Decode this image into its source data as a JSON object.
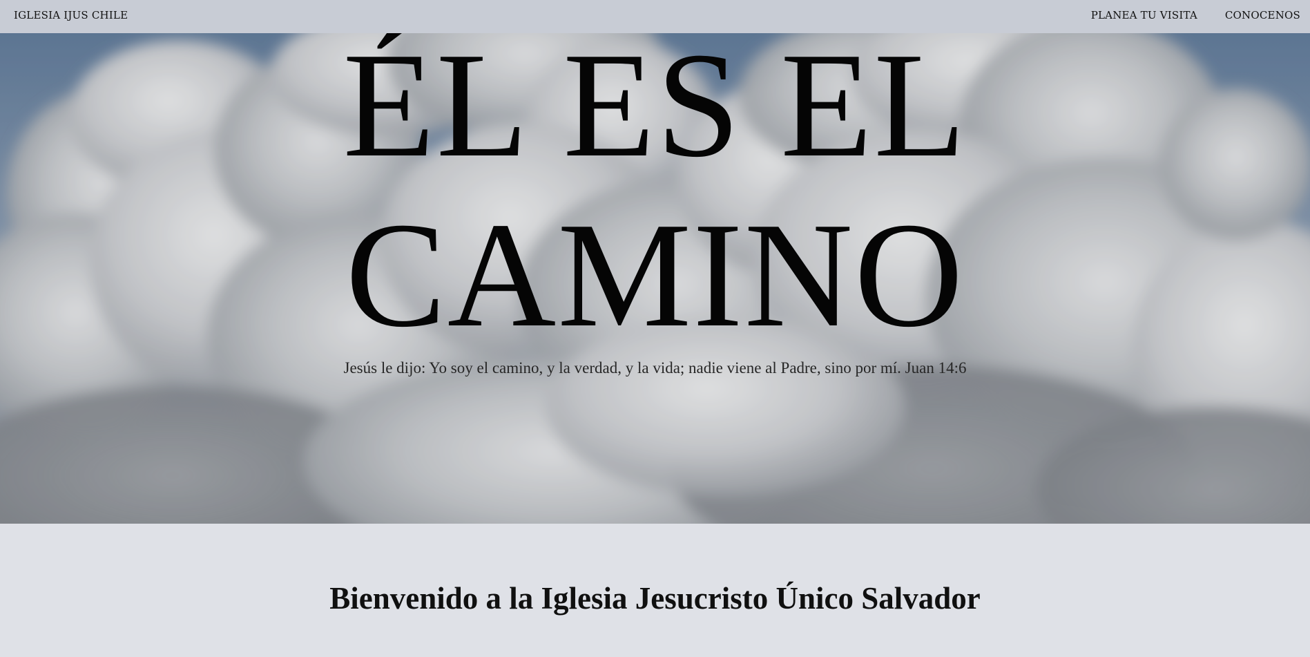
{
  "header": {
    "brand": "IGLESIA IJUS CHILE",
    "nav": [
      {
        "label": "PLANEA TU VISITA"
      },
      {
        "label": "CONOCENOS"
      }
    ]
  },
  "hero": {
    "title_line1": "ÉL ES EL",
    "title_line2": "CAMINO",
    "verse": "Jesús le dijo: Yo soy el camino, y la verdad, y la vida; nadie viene al Padre, sino por mí. Juan 14:6",
    "background": "clouds-sky-image"
  },
  "welcome": {
    "title": "Bienvenido a la Iglesia Jesucristo Único Salvador"
  },
  "colors": {
    "navbar_bg": "#c8ccd5",
    "page_bg": "#dfe1e7",
    "sky": "#5d7898",
    "text": "#050505"
  }
}
